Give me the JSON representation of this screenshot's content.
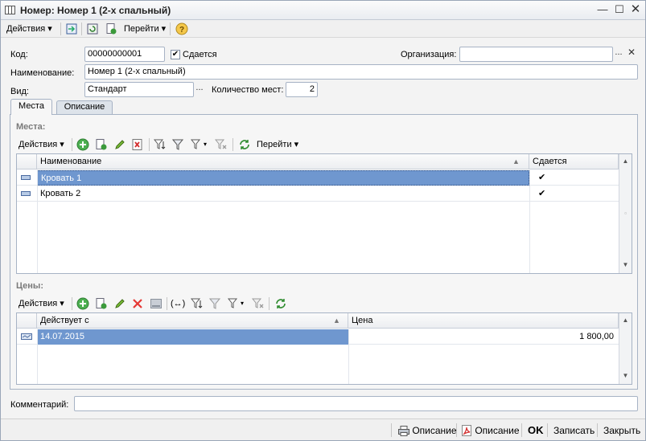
{
  "window": {
    "title": "Номер: Номер 1 (2-х спальный)"
  },
  "toolbar": {
    "actions_label": "Действия",
    "goto_label": "Перейти"
  },
  "form": {
    "code_label": "Код:",
    "code_value": "00000000001",
    "rented_checkbox_label": "Сдается",
    "rented_checked": "✔",
    "org_label": "Организация:",
    "org_value": "",
    "name_label": "Наименование:",
    "name_value": "Номер 1 (2-х спальный)",
    "type_label": "Вид:",
    "type_value": "Стандарт",
    "places_count_label": "Количество мест:",
    "places_count_value": "2",
    "comment_label": "Комментарий:",
    "comment_value": ""
  },
  "tabs": [
    {
      "label": "Места"
    },
    {
      "label": "Описание"
    }
  ],
  "places": {
    "section_label": "Места:",
    "actions_label": "Действия",
    "goto_label": "Перейти",
    "columns": [
      "Наименование",
      "Сдается"
    ],
    "rows": [
      {
        "name": "Кровать 1",
        "rented": "✔"
      },
      {
        "name": "Кровать 2",
        "rented": "✔"
      }
    ]
  },
  "prices": {
    "section_label": "Цены:",
    "actions_label": "Действия",
    "columns": [
      "Действует с",
      "Цена"
    ],
    "rows": [
      {
        "date": "14.07.2015",
        "price": "1 800,00"
      }
    ]
  },
  "footer": {
    "print_desc_label": "Описание",
    "pdf_desc_label": "Описание",
    "ok_label": "OK",
    "save_label": "Записать",
    "close_label": "Закрыть"
  }
}
